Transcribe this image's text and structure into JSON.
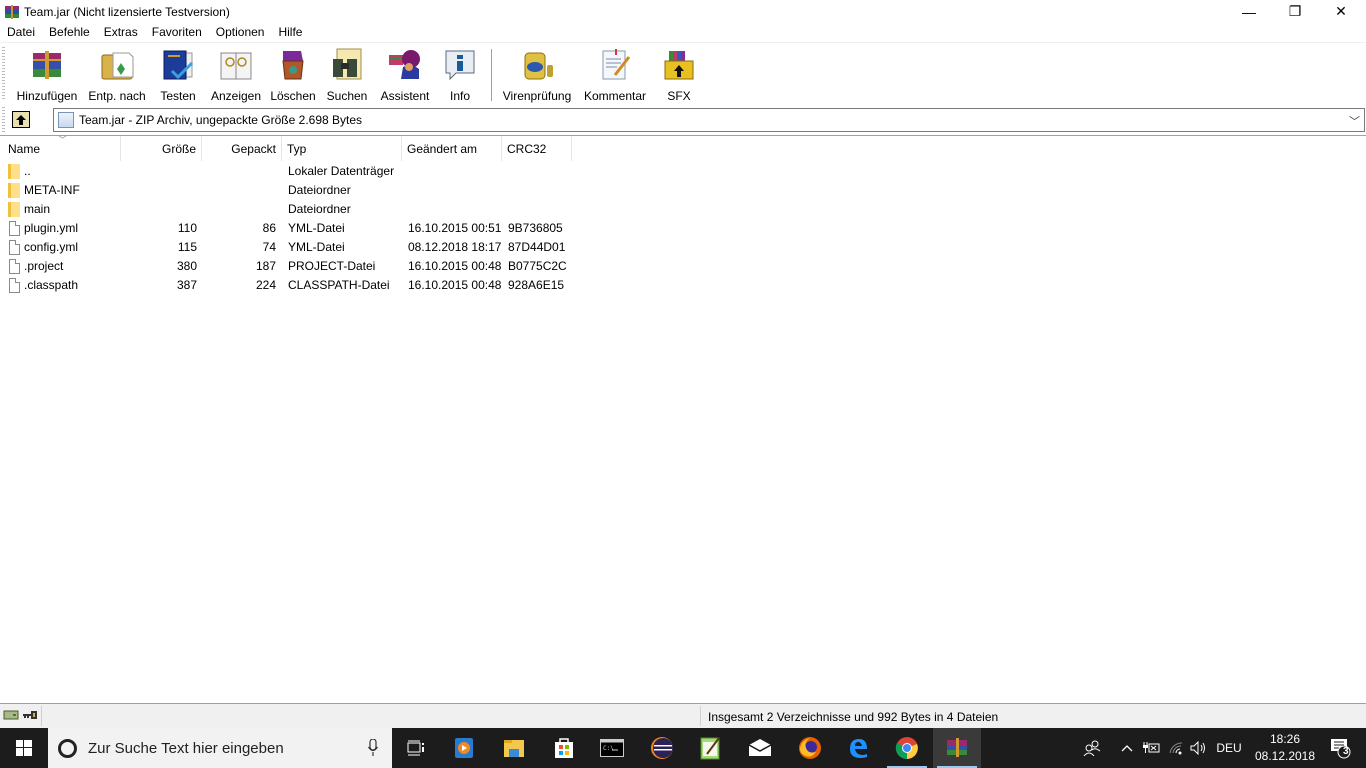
{
  "window": {
    "title": "Team.jar (Nicht lizensierte Testversion)",
    "controls": {
      "minimize": "—",
      "restore": "❐",
      "close": "✕"
    }
  },
  "menu": {
    "items": [
      "Datei",
      "Befehle",
      "Extras",
      "Favoriten",
      "Optionen",
      "Hilfe"
    ]
  },
  "toolbar": {
    "buttons": [
      {
        "label": "Hinzufügen",
        "icon": "add-archive-icon"
      },
      {
        "label": "Entp. nach",
        "icon": "extract-to-icon"
      },
      {
        "label": "Testen",
        "icon": "test-icon"
      },
      {
        "label": "Anzeigen",
        "icon": "view-icon"
      },
      {
        "label": "Löschen",
        "icon": "delete-icon"
      },
      {
        "label": "Suchen",
        "icon": "find-icon"
      },
      {
        "label": "Assistent",
        "icon": "wizard-icon"
      },
      {
        "label": "Info",
        "icon": "info-icon"
      },
      {
        "label": "Virenprüfung",
        "icon": "virus-scan-icon"
      },
      {
        "label": "Kommentar",
        "icon": "comment-icon"
      },
      {
        "label": "SFX",
        "icon": "sfx-icon"
      }
    ]
  },
  "address": {
    "text": "Team.jar - ZIP Archiv, ungepackte Größe 2.698 Bytes"
  },
  "list": {
    "columns": [
      "Name",
      "Größe",
      "Gepackt",
      "Typ",
      "Geändert am",
      "CRC32"
    ],
    "rows": [
      {
        "name": "..",
        "size": "",
        "packed": "",
        "type": "Lokaler Datenträger",
        "modified": "",
        "crc": "",
        "kind": "folder"
      },
      {
        "name": "META-INF",
        "size": "",
        "packed": "",
        "type": "Dateiordner",
        "modified": "",
        "crc": "",
        "kind": "folder"
      },
      {
        "name": "main",
        "size": "",
        "packed": "",
        "type": "Dateiordner",
        "modified": "",
        "crc": "",
        "kind": "folder"
      },
      {
        "name": "plugin.yml",
        "size": "110",
        "packed": "86",
        "type": "YML-Datei",
        "modified": "16.10.2015 00:51",
        "crc": "9B736805",
        "kind": "file"
      },
      {
        "name": "config.yml",
        "size": "115",
        "packed": "74",
        "type": "YML-Datei",
        "modified": "08.12.2018 18:17",
        "crc": "87D44D01",
        "kind": "file"
      },
      {
        "name": ".project",
        "size": "380",
        "packed": "187",
        "type": "PROJECT-Datei",
        "modified": "16.10.2015 00:48",
        "crc": "B0775C2C",
        "kind": "file"
      },
      {
        "name": ".classpath",
        "size": "387",
        "packed": "224",
        "type": "CLASSPATH-Datei",
        "modified": "16.10.2015 00:48",
        "crc": "928A6E15",
        "kind": "file"
      }
    ]
  },
  "status": {
    "text": "Insgesamt 2 Verzeichnisse und 992 Bytes in 4 Dateien"
  },
  "taskbar": {
    "search_placeholder": "Zur Suche Text hier eingeben",
    "apps": [
      "task-view",
      "media-player",
      "file-explorer",
      "store",
      "command-prompt",
      "eclipse",
      "notepad-plus",
      "mail",
      "firefox",
      "edge",
      "chrome",
      "winrar"
    ],
    "active_app": "winrar",
    "tray": {
      "language": "DEU",
      "time": "18:26",
      "date": "08.12.2018",
      "notifications": "3"
    }
  }
}
